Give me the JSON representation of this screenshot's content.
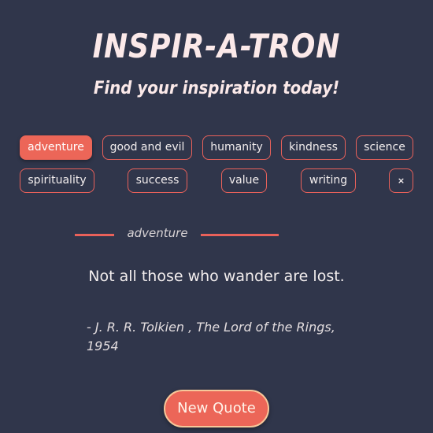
{
  "header": {
    "title": "INSPIR-A-TRON",
    "subtitle": "Find your inspiration today!"
  },
  "tags": {
    "items": [
      {
        "label": "adventure",
        "active": true
      },
      {
        "label": "good and evil"
      },
      {
        "label": "humanity"
      },
      {
        "label": "kindness"
      },
      {
        "label": "science"
      },
      {
        "label": "spirituality"
      },
      {
        "label": "success"
      },
      {
        "label": "value"
      },
      {
        "label": "writing"
      }
    ],
    "clear_label": "×"
  },
  "quote": {
    "category": "adventure",
    "text": "Not all those who wander are lost.",
    "attribution": "- J. R. R. Tolkien , The Lord of the Rings, 1954"
  },
  "actions": {
    "new_quote_label": "New Quote"
  },
  "colors": {
    "background": "#30364b",
    "accent": "#ec6658",
    "button_border": "#f7c79a"
  }
}
